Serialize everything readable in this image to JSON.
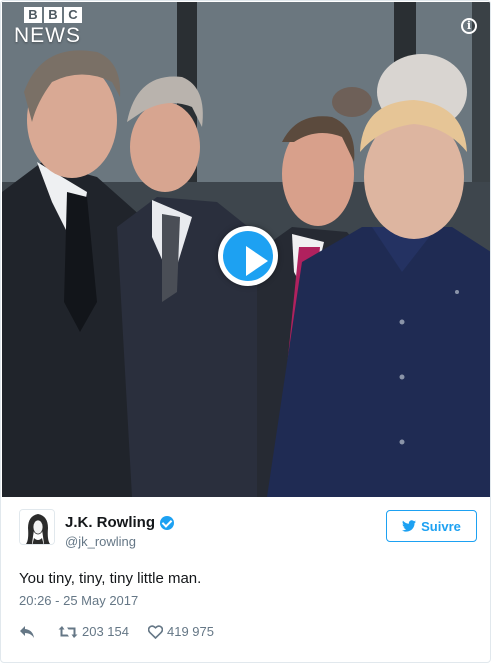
{
  "media": {
    "broadcaster_top": [
      "B",
      "B",
      "C"
    ],
    "broadcaster_bottom": "NEWS",
    "info_icon": "info-icon",
    "play_icon": "play-icon",
    "accent": "#1da1f2"
  },
  "user": {
    "display_name": "J.K. Rowling",
    "handle": "@jk_rowling",
    "verified": true,
    "avatar_icon": "avatar-illustration"
  },
  "follow": {
    "label": "Suivre",
    "icon": "twitter-bird-icon"
  },
  "tweet": {
    "text": "You tiny, tiny, tiny little man.",
    "timestamp": "20:26 - 25 May 2017"
  },
  "actions": {
    "reply_icon": "reply-icon",
    "retweet_icon": "retweet-icon",
    "retweet_count": "203 154",
    "like_icon": "heart-icon",
    "like_count": "419 975"
  },
  "colors": {
    "text": "#14171a",
    "secondary": "#657786",
    "accent": "#1da1f2",
    "border": "#e1e8ed"
  }
}
